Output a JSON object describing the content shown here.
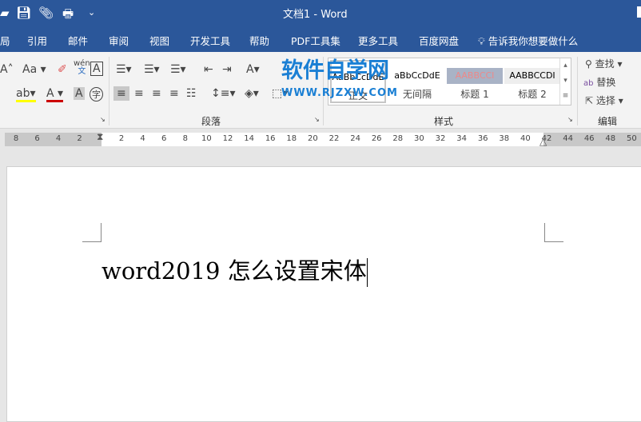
{
  "titlebar": {
    "title": "文档1  -  Word",
    "qat": [
      "open-icon",
      "save-icon",
      "attach-icon",
      "print-icon",
      "customize-icon"
    ]
  },
  "tabs": [
    "局",
    "引用",
    "邮件",
    "审阅",
    "视图",
    "开发工具",
    "帮助",
    "PDF工具集",
    "更多工具",
    "百度网盘"
  ],
  "tell_me": "告诉我你想要做什么",
  "ribbon": {
    "font_row1": [
      "A",
      "Aa",
      "wén 文",
      "A"
    ],
    "paragraph_label": "段落",
    "styles_label": "样式",
    "styles": [
      {
        "preview": "AaBbCcDdE",
        "name": "正文"
      },
      {
        "preview": "aBbCcDdE",
        "name": "无间隔"
      },
      {
        "preview": "AABBCCI",
        "name": "标题 1"
      },
      {
        "preview": "AABBCCDI",
        "name": "标题 2"
      }
    ],
    "editing_label": "编辑",
    "find": "查找",
    "replace": "替换",
    "select": "选择"
  },
  "watermark": {
    "line1": "软件自学网",
    "line2": "WWW.RJZXW.COM"
  },
  "ruler": {
    "left": [
      "8",
      "6",
      "4",
      "2"
    ],
    "right": [
      "2",
      "4",
      "6",
      "8",
      "10",
      "12",
      "14",
      "16",
      "18",
      "20",
      "22",
      "24",
      "26",
      "28",
      "30",
      "32",
      "34",
      "36",
      "38",
      "40",
      "42",
      "44",
      "46",
      "48",
      "50"
    ]
  },
  "document": {
    "text": "word2019 怎么设置宋体"
  },
  "colors": {
    "brand": "#2b579a"
  }
}
